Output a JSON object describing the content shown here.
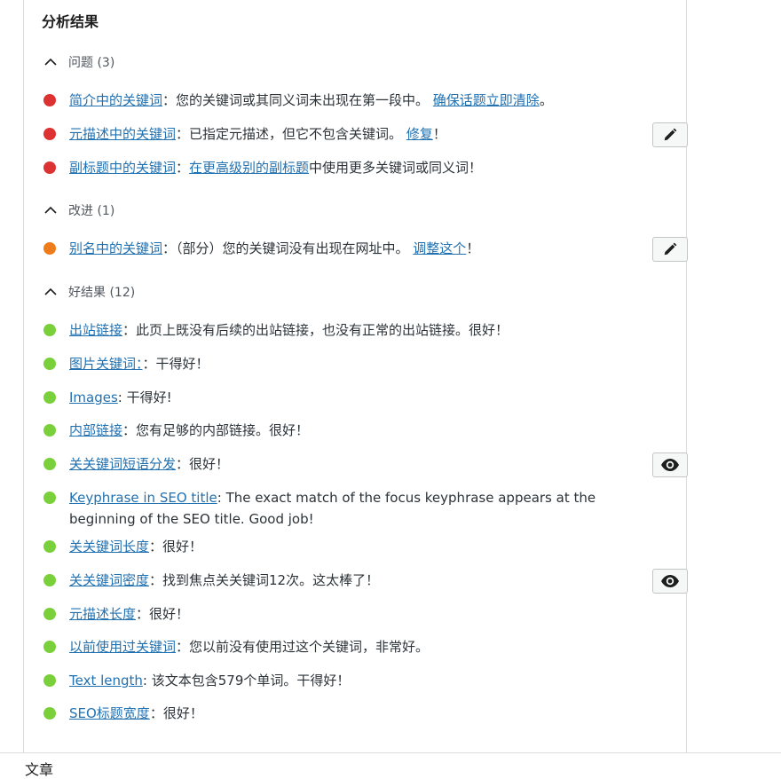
{
  "panel": {
    "title": "分析结果"
  },
  "groups": {
    "problems": {
      "label": "问题 (3)"
    },
    "improvements": {
      "label": "改进 (1)"
    },
    "good": {
      "label": "好结果 (12)"
    }
  },
  "items": {
    "intro": {
      "link": "简介中的关键词",
      "text": "：您的关键词或其同义词未出现在第一段中。 ",
      "link2": "确保话题立即清除",
      "suffix": "。"
    },
    "meta": {
      "link": "元描述中的关键词",
      "text": "：已指定元描述，但它不包含关键词。 ",
      "link2": "修复",
      "suffix": "！"
    },
    "subheading": {
      "link": "副标题中的关键词",
      "text": "：",
      "link2": "在更高级别的副标题",
      "suffix": "中使用更多关键词或同义词！"
    },
    "slug": {
      "link": "别名中的关键词",
      "text": "：（部分）您的关键词没有出现在网址中。 ",
      "link2": "调整这个",
      "suffix": "！"
    },
    "outbound": {
      "link": "出站链接",
      "text": "：此页上既没有后续的出站链接，也没有正常的出站链接。很好！"
    },
    "image_keyword": {
      "link": "图片关键词：",
      "text": "：干得好！"
    },
    "images": {
      "link": "Images",
      "text": ": 干得好!"
    },
    "internal": {
      "link": "内部链接",
      "text": "：您有足够的内部链接。很好！"
    },
    "distribution": {
      "link": "关关键词短语分发",
      "text": "：很好！"
    },
    "seo_title_kw": {
      "link": "Keyphrase in SEO title",
      "text": ": The exact match of the focus keyphrase appears at the beginning of the SEO title. Good job!"
    },
    "kw_length": {
      "link": "关关键词长度",
      "text": "：很好！"
    },
    "kw_density": {
      "link": "关关键词密度",
      "text": "：找到焦点关关键词12次。这太棒了！"
    },
    "meta_length": {
      "link": "元描述长度",
      "text": "：很好！"
    },
    "prev_used": {
      "link": "以前使用过关键词",
      "text": "：您以前没有使用过这个关键词，非常好。"
    },
    "text_length": {
      "link": "Text length",
      "text": ": 该文本包含579个单词。干得好！"
    },
    "seo_width": {
      "link": "SEO标题宽度",
      "text": "：很好！"
    }
  },
  "status_colors": {
    "problem": "#dc3232",
    "improvement": "#ee7c1b",
    "good": "#7ad03a"
  },
  "icons": {
    "edit": "pencil-icon",
    "view": "eye-icon",
    "collapse": "chevron-up-icon"
  },
  "footer": {
    "label": "文章"
  }
}
